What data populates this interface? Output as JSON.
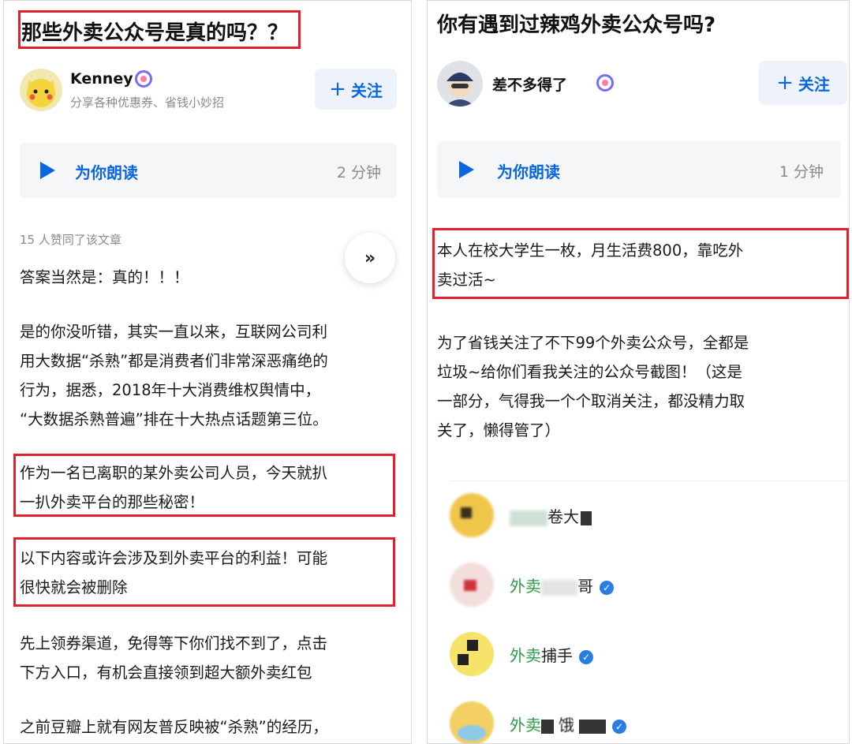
{
  "left": {
    "title": "那些外卖公众号是真的吗？？",
    "author": {
      "name": "Kenney",
      "bio": "分享各种优惠券、省钱小妙招"
    },
    "follow_label": "关注",
    "read_aloud": {
      "label": "为你朗读",
      "duration": "2 分钟"
    },
    "likes_meta": "15 人赞同了该文章",
    "paragraphs": [
      [
        "答案当然是：真的！！！"
      ],
      [
        "是的你没听错，其实一直以来，互联网公司利",
        "用大数据“杀熟”都是消费者们非常深恶痛绝的",
        "行为，据悉，2018年十大消费维权舆情中，",
        "“大数据杀熟普遍”排在十大热点话题第三位。"
      ],
      [
        "作为一名已离职的某外卖公司人员，今天就扒",
        "一扒外卖平台的那些秘密！"
      ],
      [
        "以下内容或许会涉及到外卖平台的利益！可能",
        "很快就会被删除"
      ],
      [
        "先上领券渠道，免得等下你们找不到了，点击",
        "下方入口，有机会直接领到超大额外卖红包"
      ],
      [
        "之前豆瓣上就有网友普反映被“杀熟”的经历，"
      ]
    ]
  },
  "right": {
    "title": "你有遇到过辣鸡外卖公众号吗?",
    "author": {
      "name": "差不多得了"
    },
    "follow_label": "关注",
    "read_aloud": {
      "label": "为你朗读",
      "duration": "1 分钟"
    },
    "paragraphs": [
      [
        "本人在校大学生一枚，月生活费800，靠吃外",
        "卖过活~"
      ],
      [
        "为了省钱关注了不下99个外卖公众号，全都是",
        "垃圾~给你们看我关注的公众号截图！（这是",
        "一部分，气得我一个个取消关注，都没精力取",
        "关了，懒得管了）"
      ]
    ],
    "accounts": [
      {
        "visible_text": "卷大"
      },
      {
        "prefix": "外卖",
        "suffix": "哥"
      },
      {
        "prefix": "外卖",
        "suffix": "捕手"
      },
      {
        "prefix": "外卖",
        "suffix": "饿"
      }
    ]
  },
  "colors": {
    "accent_blue": "#0a66e0",
    "highlight_red": "#e5202e",
    "account_green": "#2e9a4a"
  },
  "icons": [
    "play-icon",
    "plus-icon",
    "chevron-double-down-icon",
    "verified-icon",
    "creator-badge-icon"
  ]
}
